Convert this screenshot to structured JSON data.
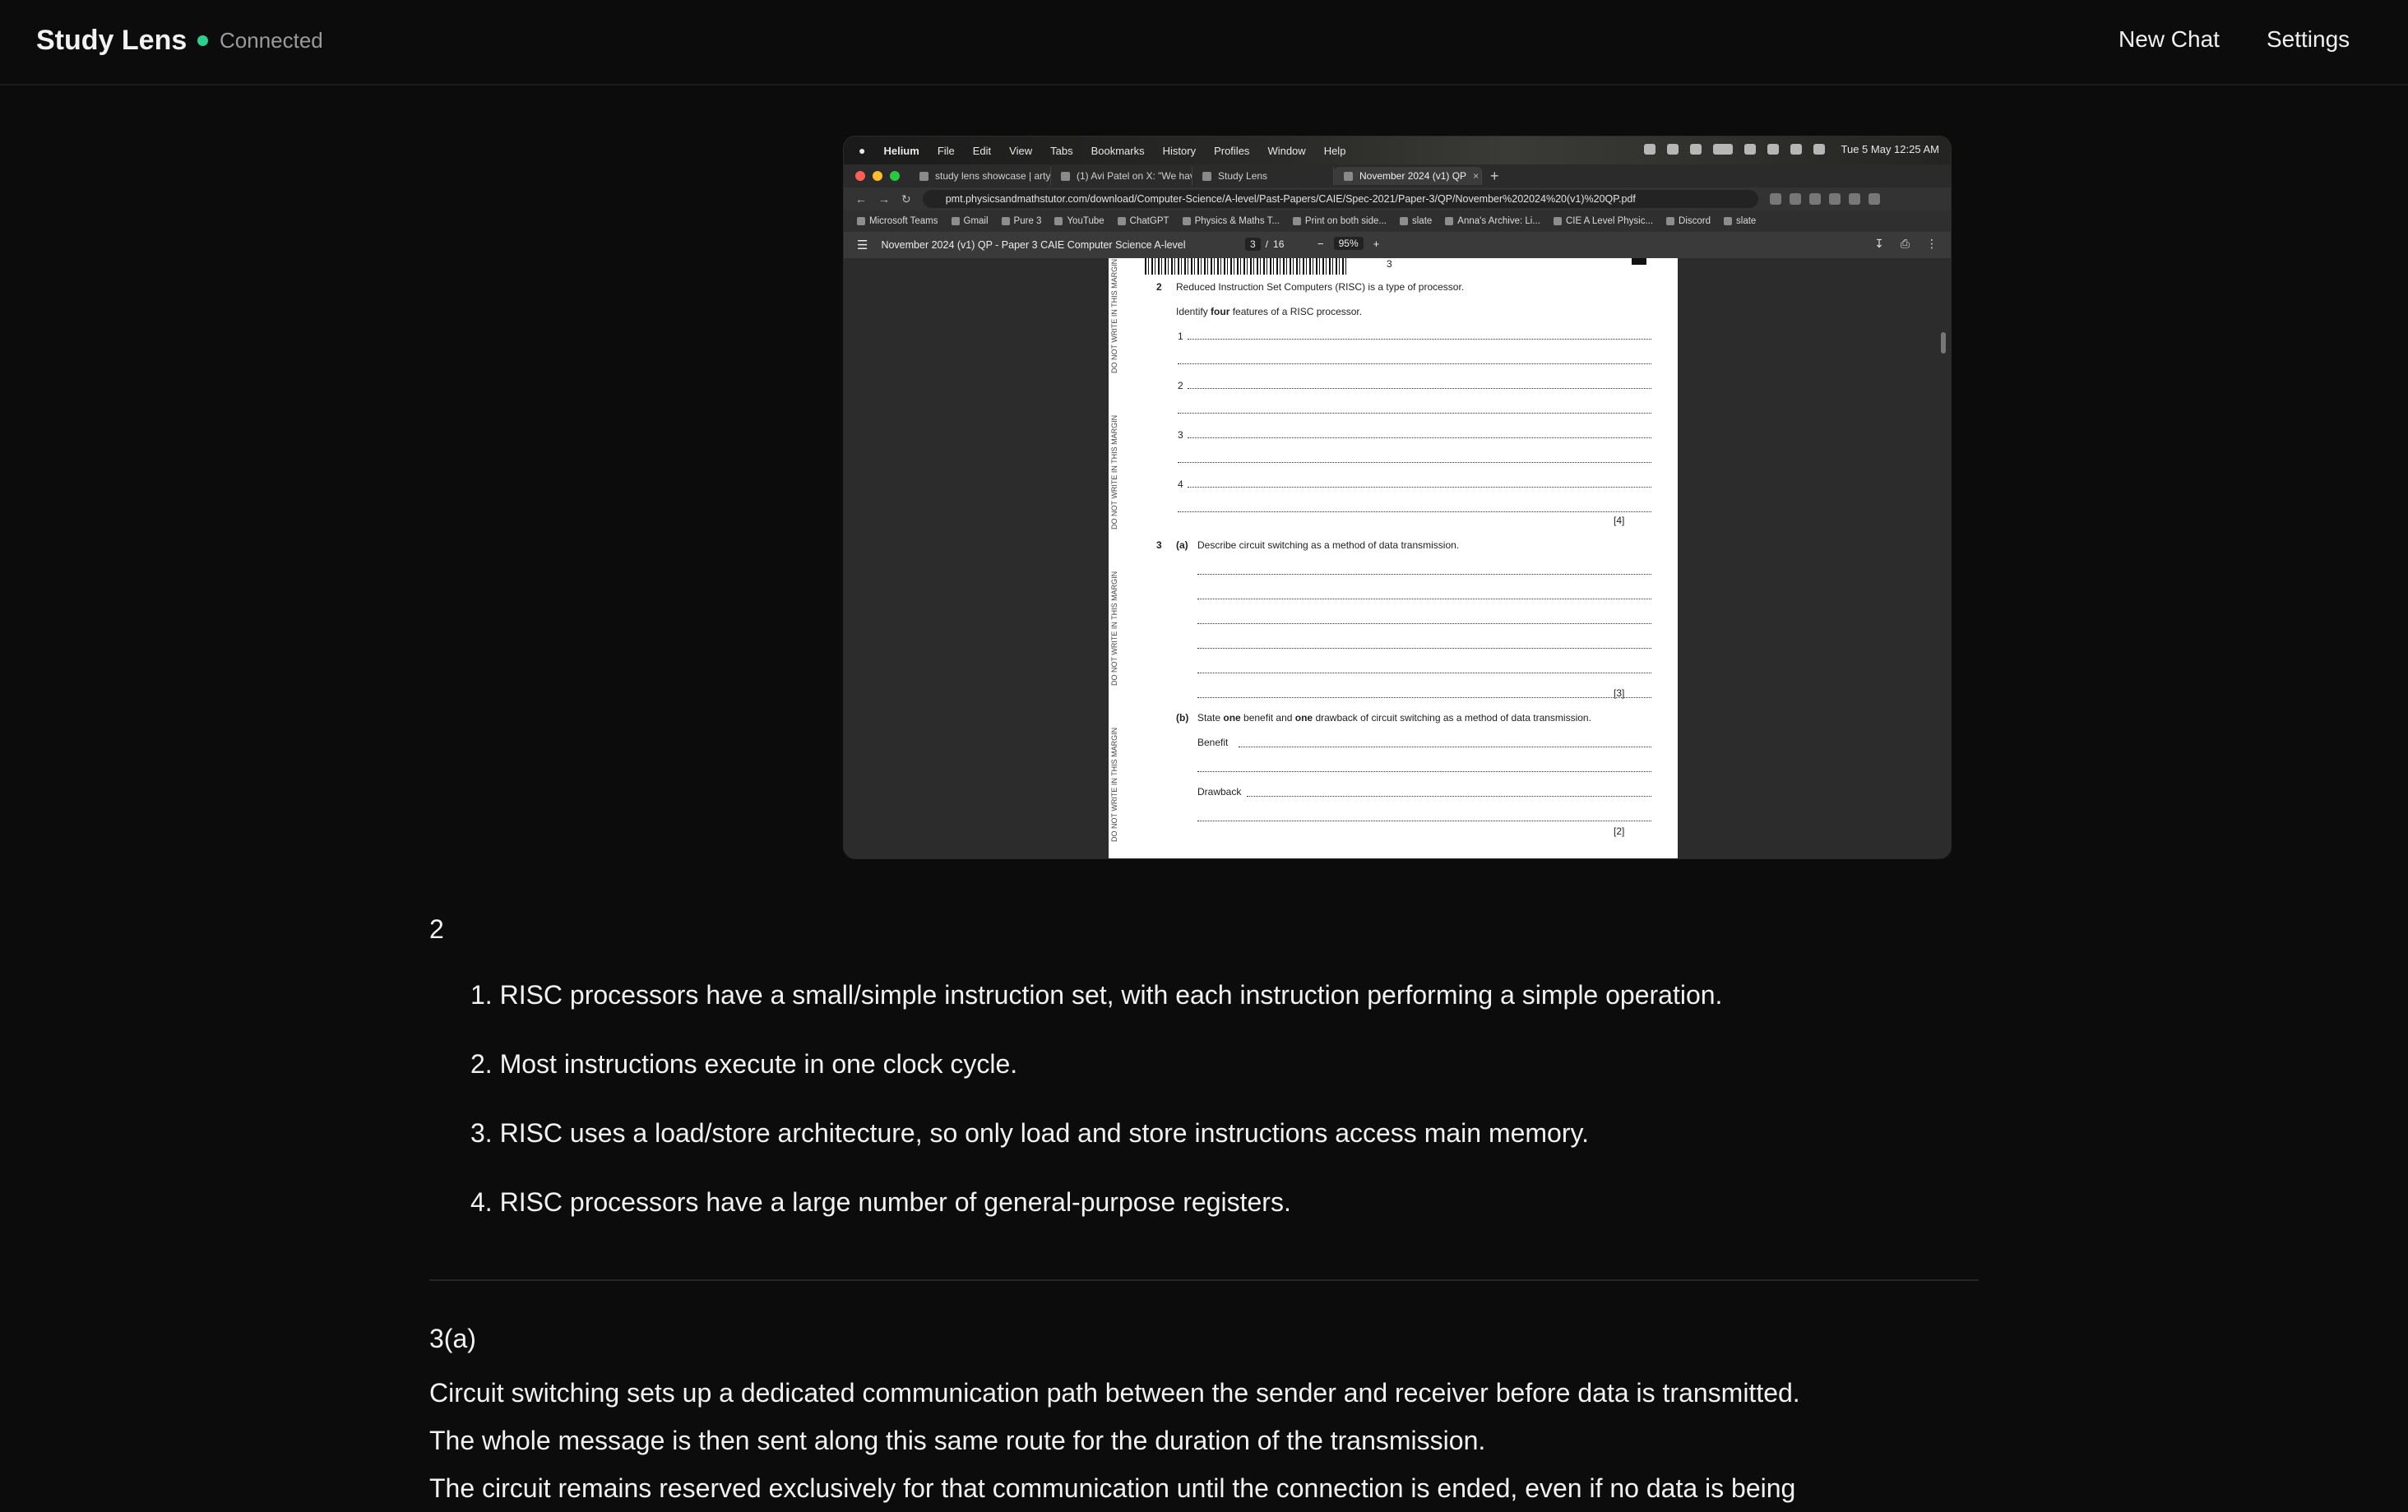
{
  "header": {
    "brand": "Study Lens",
    "status": "Connected",
    "new_chat": "New Chat",
    "settings": "Settings",
    "status_color": "#2ccf8c"
  },
  "screenshot": {
    "menubar": {
      "app": "Helium",
      "items": [
        "File",
        "Edit",
        "View",
        "Tabs",
        "Bookmarks",
        "History",
        "Profiles",
        "Window",
        "Help"
      ],
      "clock": "Tue 5 May  12:25 AM"
    },
    "tabs": [
      {
        "label": "study lens showcase | artyo"
      },
      {
        "label": "(1) Avi Patel on X: \"We have"
      },
      {
        "label": "Study Lens"
      },
      {
        "label": "November 2024 (v1) QP"
      }
    ],
    "url": "pmt.physicsandmathstutor.com/download/Computer-Science/A-level/Past-Papers/CAIE/Spec-2021/Paper-3/QP/November%202024%20(v1)%20QP.pdf",
    "bookmarks": [
      "Microsoft Teams",
      "Gmail",
      "Pure 3",
      "YouTube",
      "ChatGPT",
      "Physics & Maths T...",
      "Print on both side...",
      "slate",
      "Anna's Archive: Li...",
      "CIE A Level Physic...",
      "Discord",
      "slate"
    ],
    "pdf": {
      "title": "November 2024 (v1) QP - Paper 3 CAIE Computer Science A-level",
      "page": "3",
      "page_sep": "/",
      "total": "16",
      "zoom": "95%",
      "page_number": "3",
      "margin_text": "DO NOT WRITE IN THIS MARGIN",
      "q2_num": "2",
      "q2_text": "Reduced Instruction Set Computers (RISC) is a type of processor.",
      "q2_instr_pre": "Identify ",
      "q2_instr_bold": "four",
      "q2_instr_post": " features of a RISC processor.",
      "q2_lines": [
        "1",
        "2",
        "3",
        "4"
      ],
      "q2_marks": "[4]",
      "q3_num": "3",
      "q3a_label": "(a)",
      "q3a_text": "Describe circuit switching as a method of data transmission.",
      "q3a_marks": "[3]",
      "q3b_label": "(b)",
      "q3b_pre": "State ",
      "q3b_bold1": "one",
      "q3b_mid": " benefit and ",
      "q3b_bold2": "one",
      "q3b_post": " drawback of circuit switching as a method of data transmission.",
      "benefit": "Benefit",
      "drawback": "Drawback",
      "q3b_marks": "[2]"
    }
  },
  "answers": {
    "q2_label": "2",
    "q2_items": [
      "1. RISC processors have a small/simple instruction set, with each instruction performing a simple operation.",
      "2. Most instructions execute in one clock cycle.",
      "3. RISC uses a load/store architecture, so only load and store instructions access main memory.",
      "4. RISC processors have a large number of general-purpose registers."
    ],
    "q3a_label": "3(a)",
    "q3a_paragraph": [
      "Circuit switching sets up a dedicated communication path between the sender and receiver before data is transmitted.",
      "The whole message is then sent along this same route for the duration of the transmission.",
      "The circuit remains reserved exclusively for that communication until the connection is ended, even if no data is being"
    ]
  }
}
